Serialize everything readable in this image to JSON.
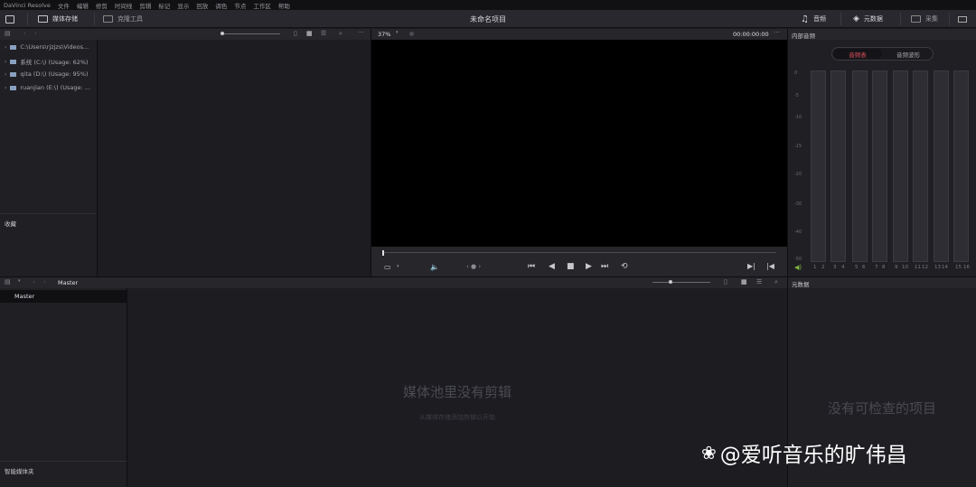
{
  "menubar": {
    "app_name": "DaVinci Resolve",
    "items": [
      "文件",
      "编辑",
      "修剪",
      "时间线",
      "剪辑",
      "标记",
      "显示",
      "回放",
      "调色",
      "节点",
      "工作区",
      "帮助"
    ]
  },
  "toolbar": {
    "media_storage": "媒体存储",
    "clone_tool": "克隆工具",
    "project_title": "未命名项目",
    "audio": "音频",
    "metadata": "元数据",
    "capture": "采集"
  },
  "media_storage_panel": {
    "drives": [
      {
        "label": "C:\\Users\\rjzjzs\\Videos..."
      },
      {
        "label": "系统 (C:\\) (Usage: 62%)"
      },
      {
        "label": "qita (D:\\) (Usage: 95%)"
      },
      {
        "label": "ruanjian (E:\\) (Usage: ..."
      }
    ],
    "favorites_label": "收藏"
  },
  "viewer": {
    "zoom": "37%",
    "timecode": "00:00:00:00"
  },
  "audio_panel": {
    "title": "内部音频",
    "tab_meters": "音频表",
    "tab_waveform": "音频波形",
    "scale": [
      "0",
      "-5",
      "-10",
      "-15",
      "-20",
      "-30",
      "-40",
      "-50"
    ],
    "channels": [
      "1",
      "2",
      "3",
      "4",
      "5",
      "6",
      "7",
      "8",
      "9",
      "10",
      "11",
      "12",
      "13",
      "14",
      "15",
      "16"
    ]
  },
  "media_pool": {
    "bin_path": "Master",
    "tree_master": "Master",
    "smart_bins": "智能媒体夹",
    "empty_title": "媒体池里没有剪辑",
    "empty_hint": "从媒体存储添加剪辑以开始"
  },
  "metadata_panel": {
    "title": "元数据",
    "empty": "没有可检查的项目"
  },
  "watermark": "@爱听音乐的旷伟昌",
  "colors": {
    "accent_red": "#e0505a",
    "meter_green": "#7fb542",
    "bg_dark": "#1e1e23"
  }
}
